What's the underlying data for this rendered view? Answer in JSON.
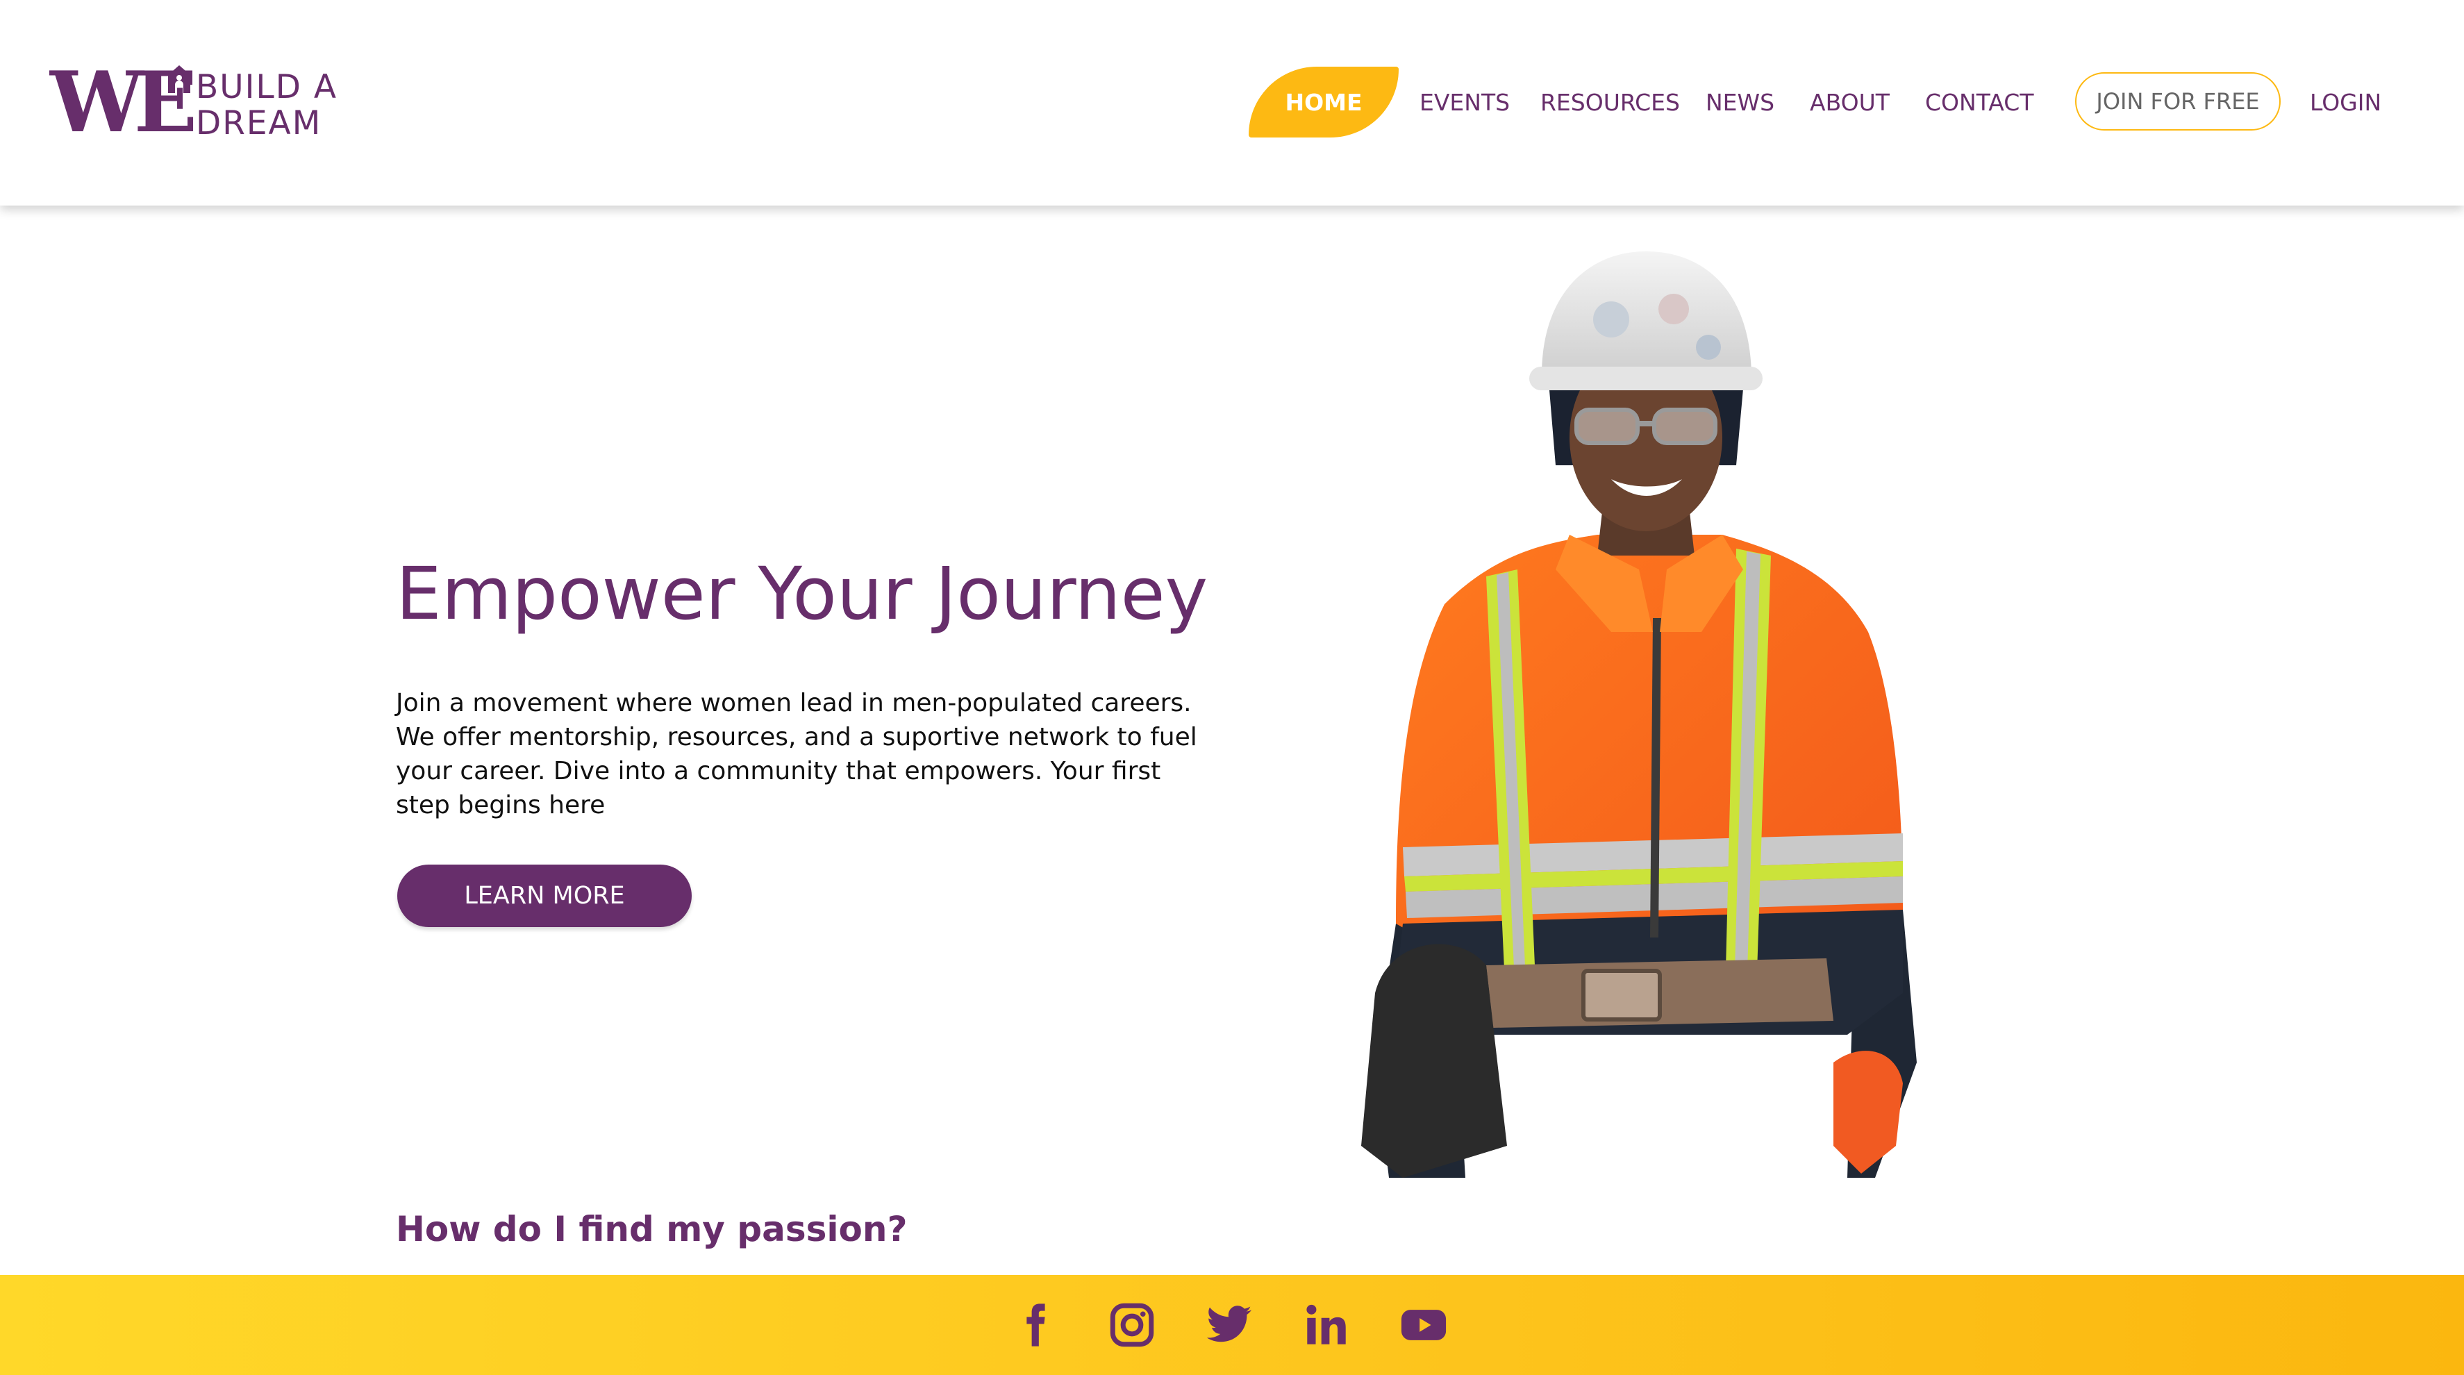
{
  "brand": {
    "logo_mark": "WE",
    "logo_line1": "BUILD A",
    "logo_line2": "DREAM",
    "colors": {
      "purple": "#672e6b",
      "gold": "#fdb913"
    }
  },
  "nav": {
    "items": [
      {
        "label": "HOME",
        "active": true
      },
      {
        "label": "EVENTS"
      },
      {
        "label": "RESOURCES"
      },
      {
        "label": "NEWS"
      },
      {
        "label": "ABOUT"
      },
      {
        "label": "CONTACT"
      }
    ],
    "join_label": "JOIN FOR FREE",
    "login_label": "LOGIN"
  },
  "hero": {
    "title": "Empower Your Journey",
    "body": "Join a movement where women lead in men-populated careers. We offer mentorship, resources, and a suportive network to fuel your career. Dive into a community that empowers. Your first step begins here",
    "cta_label": "LEARN MORE",
    "image_icon": "construction-worker-photo"
  },
  "section": {
    "heading": "How do I find my passion?"
  },
  "footer": {
    "social_icons": [
      "facebook-icon",
      "instagram-icon",
      "twitter-icon",
      "linkedin-icon",
      "youtube-icon"
    ]
  }
}
